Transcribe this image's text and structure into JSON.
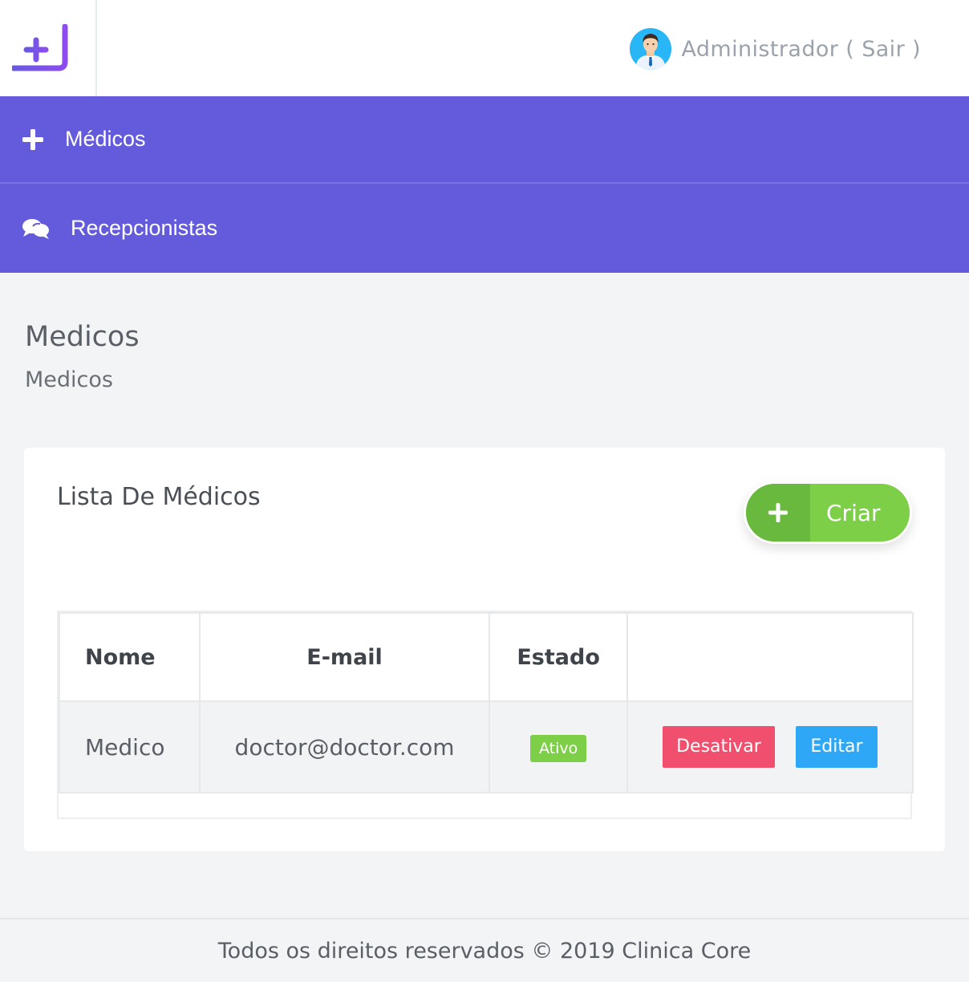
{
  "header": {
    "logo_icon": "clinic-plus-logo-icon",
    "user_label": "Administrador ( Sair )",
    "avatar_icon": "doctor-avatar-icon"
  },
  "nav": {
    "items": [
      {
        "label": "Médicos",
        "icon": "plus-icon"
      },
      {
        "label": "Recepcionistas",
        "icon": "chat-bubbles-icon"
      }
    ]
  },
  "page": {
    "title": "Medicos",
    "breadcrumb": "Medicos"
  },
  "card": {
    "title": "Lista De Médicos",
    "create_button": "Criar",
    "table": {
      "headers": [
        "Nome",
        "E-mail",
        "Estado",
        ""
      ],
      "rows": [
        {
          "name": "Medico",
          "email": "doctor@doctor.com",
          "status": "Ativo",
          "deactivate_label": "Desativar",
          "edit_label": "Editar"
        }
      ]
    }
  },
  "footer": {
    "text": "Todos os direitos reservados © 2019 Clinica Core"
  },
  "colors": {
    "nav_bg": "#635bdc",
    "success": "#7ecf48",
    "danger": "#f0506e",
    "info": "#2ea8f6"
  }
}
